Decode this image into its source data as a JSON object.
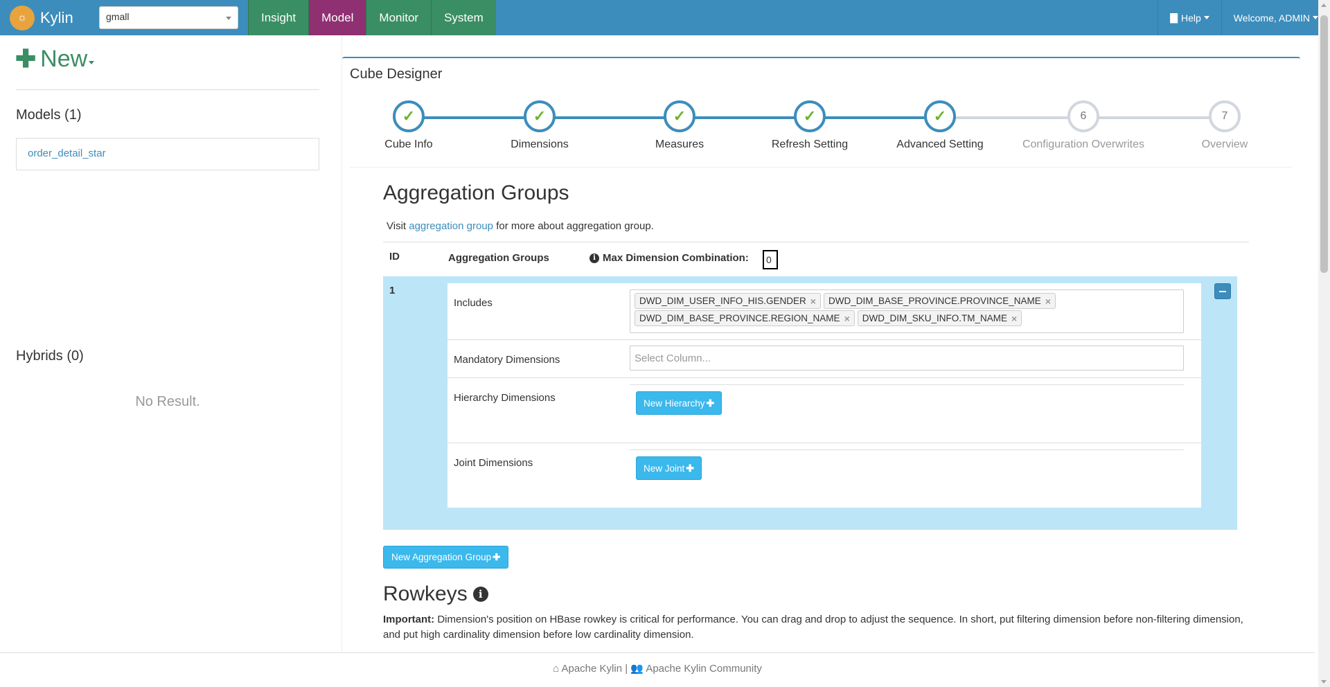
{
  "navbar": {
    "brand": "Kylin",
    "project": "gmall",
    "tabs": [
      {
        "label": "Insight"
      },
      {
        "label": "Model"
      },
      {
        "label": "Monitor"
      },
      {
        "label": "System"
      }
    ],
    "active_tab": "Model",
    "help": "Help",
    "welcome": "Welcome, ADMIN"
  },
  "sidebar": {
    "new_label": "New",
    "models_title": "Models (1)",
    "models": [
      "order_detail_star"
    ],
    "hybrids_title": "Hybrids (0)",
    "no_result": "No Result."
  },
  "designer": {
    "title": "Cube Designer",
    "steps": [
      {
        "label": "Cube Info",
        "status": "done"
      },
      {
        "label": "Dimensions",
        "status": "done"
      },
      {
        "label": "Measures",
        "status": "done"
      },
      {
        "label": "Refresh Setting",
        "status": "done"
      },
      {
        "label": "Advanced Setting",
        "status": "done"
      },
      {
        "label": "Configuration Overwrites",
        "status": "pending",
        "number": "6"
      },
      {
        "label": "Overview",
        "status": "pending",
        "number": "7"
      }
    ]
  },
  "aggregation": {
    "title": "Aggregation Groups",
    "visit_prefix": "Visit",
    "visit_link": "aggregation group",
    "visit_suffix": "for more about aggregation group.",
    "header_id": "ID",
    "header_groups": "Aggregation Groups",
    "header_max": "Max Dimension Combination:",
    "max_value": "0",
    "groups": [
      {
        "id": "1",
        "includes_label": "Includes",
        "includes": [
          "DWD_DIM_USER_INFO_HIS.GENDER",
          "DWD_DIM_BASE_PROVINCE.PROVINCE_NAME",
          "DWD_DIM_BASE_PROVINCE.REGION_NAME",
          "DWD_DIM_SKU_INFO.TM_NAME"
        ],
        "mandatory_label": "Mandatory Dimensions",
        "mandatory_placeholder": "Select Column...",
        "hierarchy_label": "Hierarchy Dimensions",
        "hierarchy_button": "New Hierarchy",
        "joint_label": "Joint Dimensions",
        "joint_button": "New Joint"
      }
    ],
    "new_group_button": "New Aggregation Group"
  },
  "rowkeys": {
    "title": "Rowkeys",
    "important_label": "Important:",
    "important_text": "Dimension's position on HBase rowkey is critical for performance. You can drag and drop to adjust the sequence. In short, put filtering dimension before non-filtering dimension, and put high cardinality dimension before low cardinality dimension."
  },
  "footer": {
    "left": "Apache Kylin",
    "separator": "|",
    "right": "Apache Kylin Community"
  },
  "colors": {
    "navbar": "#3c8dbc",
    "tab": "#3a8e63",
    "active_tab": "#8e3071",
    "step_done": "#6bb22e",
    "group_row": "#bde5f8",
    "button": "#3bb8ec"
  }
}
